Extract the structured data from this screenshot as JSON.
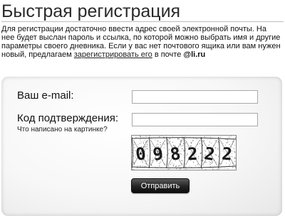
{
  "page": {
    "title": "Быстрая регистрация",
    "intro_text": "Для регистрации достаточно ввести адрес своей электронной почты. На нее будет выслан пароль и ссылка, по которой можно выбрать имя и другие параметры своего дневника. Если у вас нет почтового ящика или вам нужен новый, предлагаем ",
    "intro_link": "зарегистрировать его",
    "intro_after_link": " в почте ",
    "intro_domain": "@li.ru"
  },
  "form": {
    "email_label": "Ваш e-mail:",
    "email_value": "",
    "code_label": "Код подтверждения:",
    "code_hint": "Что написано на картинке?",
    "code_value": "",
    "captcha_text": "098222",
    "submit_label": "Отправить"
  }
}
